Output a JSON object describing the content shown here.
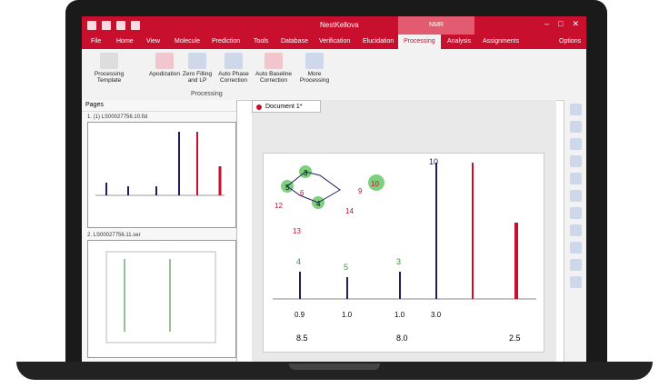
{
  "titlebar": {
    "title": "NestKellova",
    "context_tab": "NMR"
  },
  "menu": [
    "File",
    "Home",
    "View",
    "Molecule",
    "Prediction",
    "Tools",
    "Database",
    "Verification",
    "Elucidation",
    "Processing",
    "Analysis",
    "Assignments",
    "Options"
  ],
  "menu_active": "Processing",
  "ribbon": {
    "buttons": [
      "Processing Template",
      "Apodization",
      "Zero Filling and LP",
      "Auto Phase Correction",
      "Auto Baseline Correction",
      "More Processing"
    ],
    "group": "Processing"
  },
  "pages": {
    "header": "Pages",
    "items": [
      "1. (1) LS00027756.10.fid",
      "2. LS00027756.11.ser"
    ]
  },
  "document": {
    "tab": "Document 1*"
  },
  "spectrum": {
    "axis": [
      "8.5",
      "8.0",
      "2.5"
    ],
    "peak_labels": [
      "4",
      "5",
      "3",
      "10"
    ],
    "integrals": [
      "0.9",
      "1.0",
      "1.0",
      "3.0"
    ]
  },
  "molecule": {
    "labels": [
      "3",
      "5",
      "6",
      "4",
      "10",
      "9",
      "12",
      "13",
      "14"
    ]
  }
}
